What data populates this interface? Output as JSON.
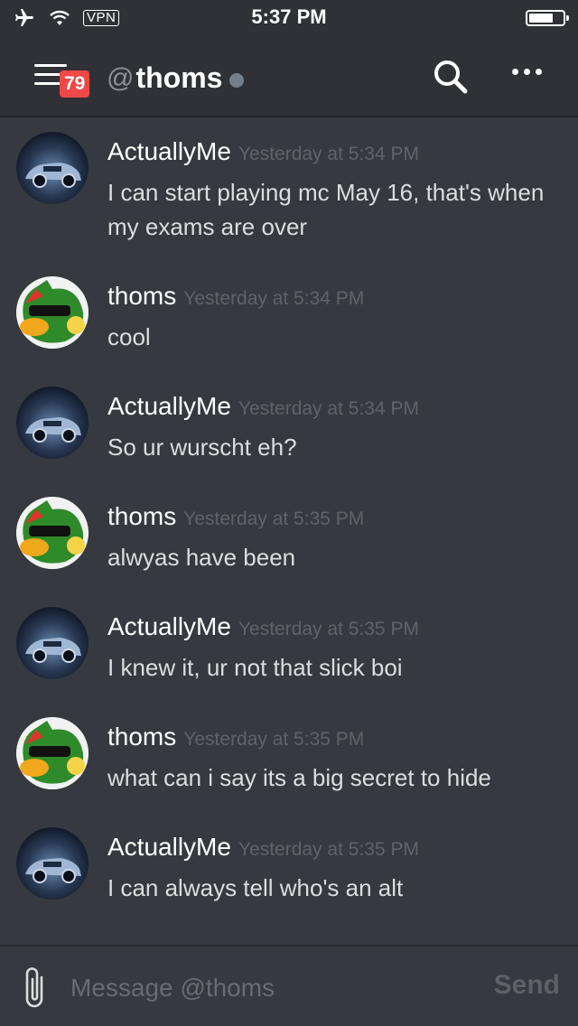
{
  "status_bar": {
    "vpn": "VPN",
    "time": "5:37 PM"
  },
  "header": {
    "unread_badge": "79",
    "at_sign": "@",
    "channel_name": "thoms"
  },
  "messages": [
    {
      "author": "ActuallyMe",
      "timestamp": "Yesterday at 5:34 PM",
      "text": "I can start playing mc May 16, that's when my exams are over"
    },
    {
      "author": "thoms",
      "timestamp": "Yesterday at 5:34 PM",
      "text": "cool"
    },
    {
      "author": "ActuallyMe",
      "timestamp": "Yesterday at 5:34 PM",
      "text": "So ur wurscht eh?"
    },
    {
      "author": "thoms",
      "timestamp": "Yesterday at 5:35 PM",
      "text": "alwyas have been"
    },
    {
      "author": "ActuallyMe",
      "timestamp": "Yesterday at 5:35 PM",
      "text": "I knew it, ur not that slick boi"
    },
    {
      "author": "thoms",
      "timestamp": "Yesterday at 5:35 PM",
      "text": "what can i say its a big secret to hide"
    },
    {
      "author": "ActuallyMe",
      "timestamp": "Yesterday at 5:35 PM",
      "text": "I can always tell who's an alt"
    }
  ],
  "composer": {
    "placeholder": "Message @thoms",
    "send_label": "Send"
  },
  "colors": {
    "background": "#36393f",
    "header": "#2f3136",
    "badge": "#f04747",
    "timestamp": "#5f6369"
  }
}
